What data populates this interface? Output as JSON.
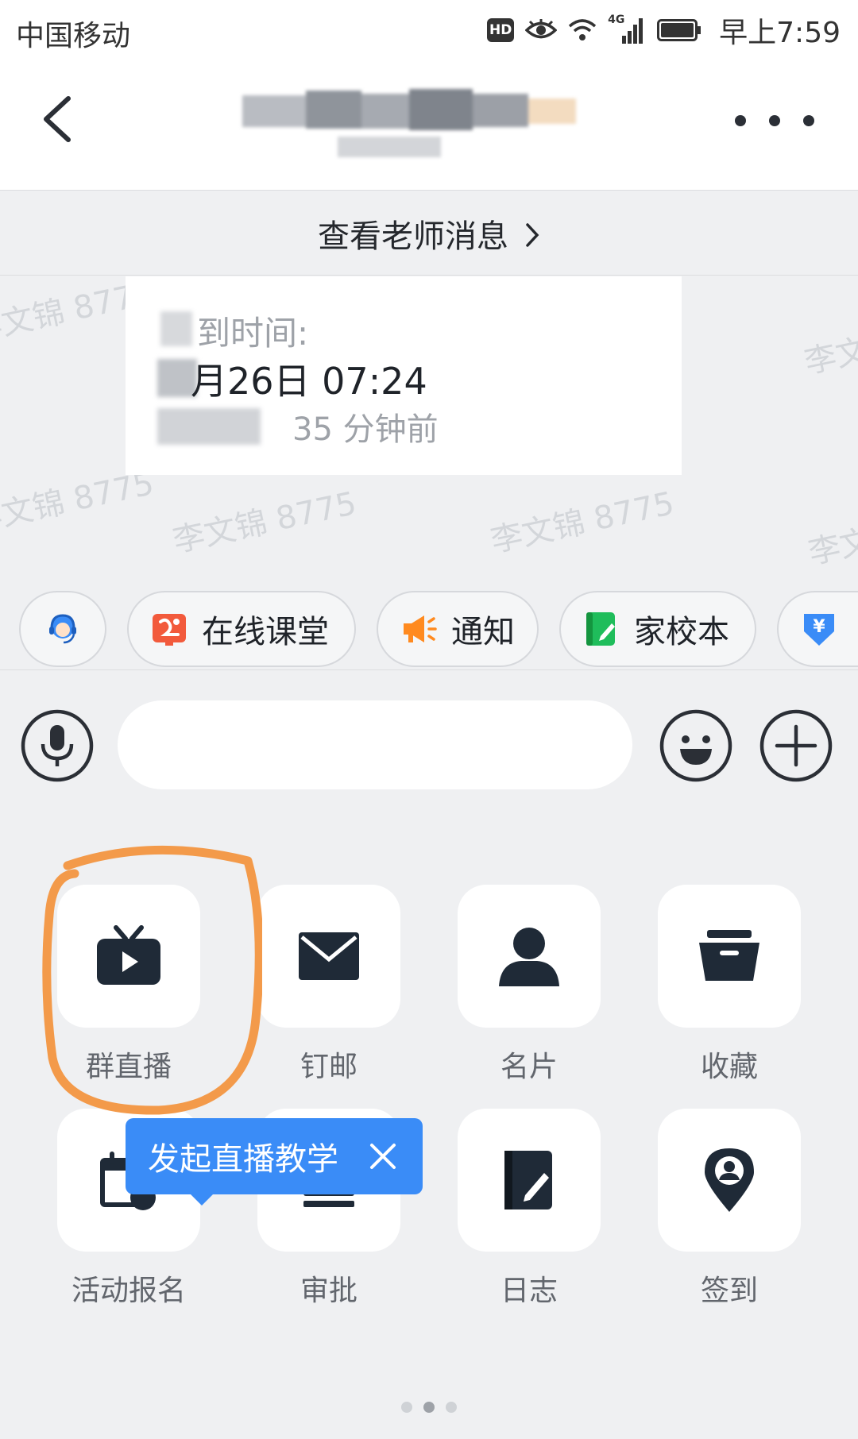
{
  "status_bar": {
    "carrier": "中国移动",
    "hd_badge": "HD",
    "network": "4G",
    "time": "早上7:59",
    "icons": [
      "hd-icon",
      "eye-icon",
      "wifi-icon",
      "signal-icon",
      "battery-icon"
    ]
  },
  "nav": {
    "back_icon": "back-arrow-icon",
    "more_icon": "more-dots-icon"
  },
  "teacher_bar": {
    "label": "查看老师消息",
    "icon": "chevron-right-icon"
  },
  "watermark": "李文锦 8775",
  "message": {
    "line1": "到时间:",
    "line2": "月26日 07:24",
    "line3": "35 分钟前"
  },
  "chips": [
    {
      "label": "",
      "icon": "customer-service-icon",
      "color": "#3a8cf7"
    },
    {
      "label": "在线课堂",
      "icon": "online-class-icon",
      "color": "#f25a3c"
    },
    {
      "label": "通知",
      "icon": "megaphone-icon",
      "color": "#ff8a1f"
    },
    {
      "label": "家校本",
      "icon": "notebook-icon",
      "color": "#1fbd5b"
    },
    {
      "label": "",
      "icon": "payment-icon",
      "color": "#3a8cf7"
    }
  ],
  "input": {
    "placeholder": "",
    "voice_icon": "microphone-icon",
    "emoji_icon": "emoji-icon",
    "plus_icon": "plus-icon"
  },
  "tools": [
    {
      "label": "群直播",
      "icon": "tv-play-icon"
    },
    {
      "label": "钉邮",
      "icon": "mail-icon"
    },
    {
      "label": "名片",
      "icon": "person-icon"
    },
    {
      "label": "收藏",
      "icon": "archive-box-icon"
    },
    {
      "label": "活动报名",
      "icon": "calendar-icon"
    },
    {
      "label": "审批",
      "icon": "approval-icon"
    },
    {
      "label": "日志",
      "icon": "journal-icon"
    },
    {
      "label": "签到",
      "icon": "location-pin-icon"
    }
  ],
  "tooltip": {
    "text": "发起直播教学",
    "close_icon": "close-icon"
  },
  "pagination": {
    "total": 3,
    "current": 2
  },
  "colors": {
    "accent": "#3a8cf7",
    "highlight": "#f39a4a",
    "icon_dark": "#1f2a37",
    "background": "#eff0f2"
  }
}
